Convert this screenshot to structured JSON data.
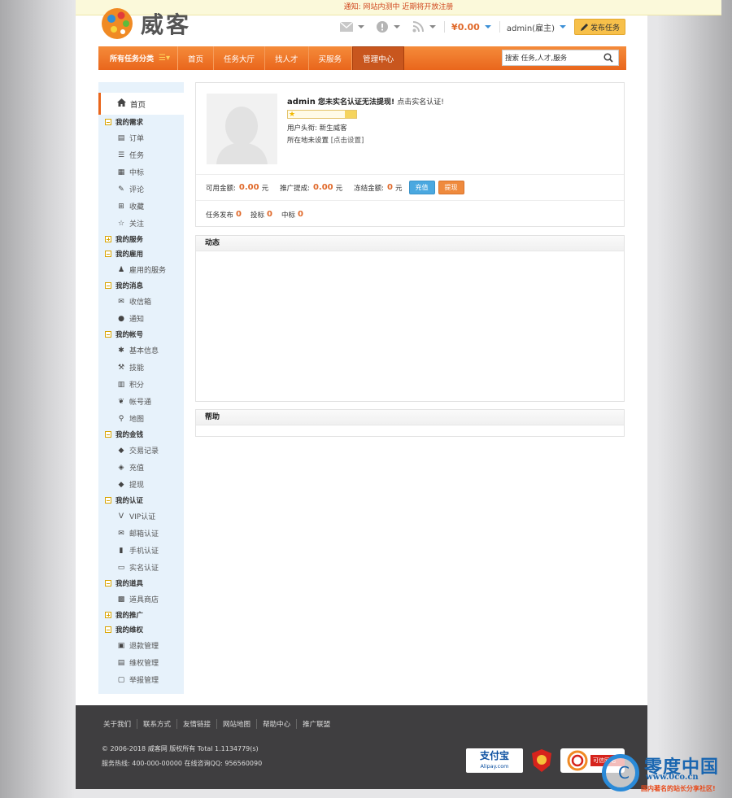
{
  "notice": "通知: 网站内测中 近期将开放注册",
  "header": {
    "logo_text": "威客",
    "balance": "¥0.00",
    "user": "admin(雇主)",
    "publish_label": "发布任务"
  },
  "nav": {
    "category_label": "所有任务分类",
    "items": [
      "首页",
      "任务大厅",
      "找人才",
      "买服务",
      "管理中心"
    ],
    "active_index": 4,
    "search_value": "搜索 任务,人才,服务"
  },
  "sidebar": {
    "home": "首页",
    "groups": [
      {
        "title": "我的需求",
        "expanded": true,
        "items": [
          {
            "label": "订单",
            "icon": "order-icon"
          },
          {
            "label": "任务",
            "icon": "list-icon"
          },
          {
            "label": "中标",
            "icon": "bid-icon"
          },
          {
            "label": "评论",
            "icon": "comment-icon"
          },
          {
            "label": "收藏",
            "icon": "plus-square-icon"
          },
          {
            "label": "关注",
            "icon": "star-icon"
          }
        ]
      },
      {
        "title": "我的服务",
        "expanded": false,
        "items": []
      },
      {
        "title": "我的雇用",
        "expanded": true,
        "items": [
          {
            "label": "雇用的服务",
            "icon": "user-icon"
          }
        ]
      },
      {
        "title": "我的消息",
        "expanded": true,
        "items": [
          {
            "label": "收信箱",
            "icon": "envelope-icon"
          },
          {
            "label": "通知",
            "icon": "alert-icon"
          }
        ]
      },
      {
        "title": "我的帐号",
        "expanded": true,
        "items": [
          {
            "label": "基本信息",
            "icon": "gear-icon"
          },
          {
            "label": "技能",
            "icon": "wrench-icon"
          },
          {
            "label": "积分",
            "icon": "gift-icon"
          },
          {
            "label": "帐号通",
            "icon": "leaf-icon"
          },
          {
            "label": "地图",
            "icon": "map-pin-icon"
          }
        ]
      },
      {
        "title": "我的金钱",
        "expanded": true,
        "items": [
          {
            "label": "交易记录",
            "icon": "money-icon"
          },
          {
            "label": "充值",
            "icon": "recharge-icon"
          },
          {
            "label": "提现",
            "icon": "withdraw-icon"
          }
        ]
      },
      {
        "title": "我的认证",
        "expanded": true,
        "items": [
          {
            "label": "VIP认证",
            "icon": "vip-icon"
          },
          {
            "label": "邮箱认证",
            "icon": "envelope-icon"
          },
          {
            "label": "手机认证",
            "icon": "phone-icon"
          },
          {
            "label": "实名认证",
            "icon": "id-card-icon"
          }
        ]
      },
      {
        "title": "我的道具",
        "expanded": true,
        "items": [
          {
            "label": "道具商店",
            "icon": "shop-icon"
          }
        ]
      },
      {
        "title": "我的推广",
        "expanded": false,
        "items": []
      },
      {
        "title": "我的维权",
        "expanded": true,
        "items": [
          {
            "label": "退款管理",
            "icon": "refund-icon"
          },
          {
            "label": "维权管理",
            "icon": "shield-icon"
          },
          {
            "label": "举报管理",
            "icon": "report-icon"
          }
        ]
      }
    ]
  },
  "profile": {
    "name": "admin",
    "warning": "您未实名认证无法提现!",
    "cert_link": "点击实名认证!",
    "title_label": "用户头衔:",
    "title_value": "新生威客",
    "location_label": "所在地未设置",
    "location_link": "[点击设置]"
  },
  "money": {
    "available_label": "可用金额:",
    "available": "0.00",
    "promo_label": "推广提成:",
    "promo": "0.00",
    "frozen_label": "冻结金额:",
    "frozen": "0",
    "unit": "元",
    "recharge_btn": "充值",
    "withdraw_btn": "提现"
  },
  "tasks": {
    "published_label": "任务发布",
    "published": "0",
    "bids_label": "投标",
    "bids": "0",
    "won_label": "中标",
    "won": "0"
  },
  "panels": {
    "dynamic": "动态",
    "help": "帮助"
  },
  "footer": {
    "links": [
      "关于我们",
      "联系方式",
      "友情链接",
      "网站地图",
      "帮助中心",
      "推广联盟"
    ],
    "copyright": "© 2006-2018 威客网 版权所有 Total 1.1134779(s)",
    "hotline": "服务热线: 400-000-00000 在线咨询QQ: 956560090",
    "alipay": "支付宝",
    "alipay_sub": "Alipay.com",
    "trust": "可信网站"
  },
  "watermark": {
    "title": "零度中国",
    "url": "www.0co.cn",
    "sub": "国内著名的站长分享社区!"
  },
  "colors": {
    "accent": "#e9661c",
    "amount": "#e0692a",
    "sidebar_bg": "#e7f2fb"
  }
}
